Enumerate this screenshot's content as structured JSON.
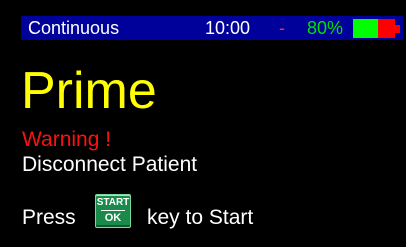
{
  "status_bar": {
    "mode": "Continuous",
    "time": "10:00",
    "separator": "-",
    "battery_percent_text": "80%",
    "battery_level": 0.6,
    "colors": {
      "strip": "#00009a",
      "battery_fill": "#00ff00",
      "battery_empty": "#ff0000",
      "percent_text": "#00e000",
      "separator": "#ff2a2a"
    }
  },
  "main": {
    "title": "Prime",
    "warning": "Warning !",
    "instruction": "Disconnect Patient",
    "press_prefix": "Press",
    "key": {
      "icon": "start-ok-key-icon",
      "top_label": "START",
      "bottom_label": "OK"
    },
    "press_suffix": "key to Start",
    "colors": {
      "title": "#ffff00",
      "warning": "#ff1010",
      "text": "#ffffff",
      "key_background": "#1a8a4a"
    }
  }
}
